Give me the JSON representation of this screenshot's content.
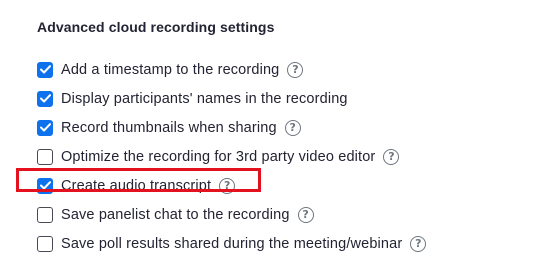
{
  "section": {
    "title": "Advanced cloud recording settings"
  },
  "options": [
    {
      "label": "Add a timestamp to the recording",
      "checked": true,
      "help": true
    },
    {
      "label": "Display participants' names in the recording",
      "checked": true,
      "help": false
    },
    {
      "label": "Record thumbnails when sharing",
      "checked": true,
      "help": true
    },
    {
      "label": "Optimize the recording for 3rd party video editor",
      "checked": false,
      "help": true
    },
    {
      "label": "Create audio transcript",
      "checked": true,
      "help": true,
      "highlighted": true
    },
    {
      "label": "Save panelist chat to the recording",
      "checked": false,
      "help": true
    },
    {
      "label": "Save poll results shared during the meeting/webinar",
      "checked": false,
      "help": true
    }
  ],
  "icons": {
    "help": "question-mark-circle-icon",
    "check": "checkmark-icon"
  },
  "colors": {
    "checkbox_checked": "#0e72ed",
    "highlight": "#e3121e",
    "text": "#232333"
  }
}
